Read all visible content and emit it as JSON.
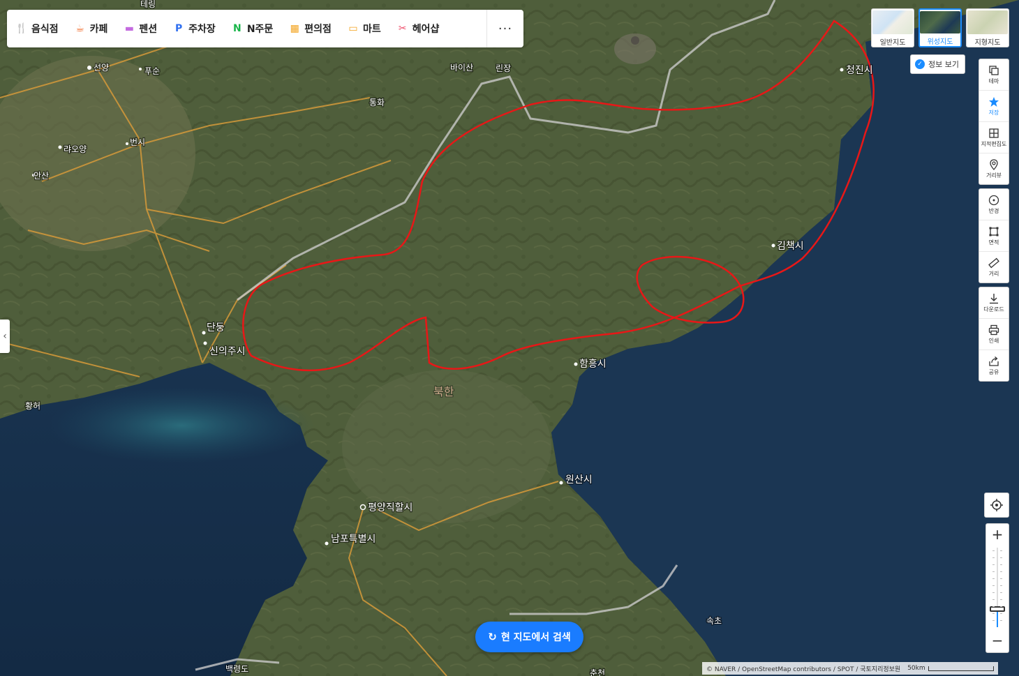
{
  "categories": [
    {
      "label": "음식점",
      "icon": "fork-knife-icon",
      "color": "#f2763b",
      "glyph": "🍴"
    },
    {
      "label": "카페",
      "icon": "coffee-cup-icon",
      "color": "#f2763b",
      "glyph": "☕"
    },
    {
      "label": "펜션",
      "icon": "bed-icon",
      "color": "#c46be0",
      "glyph": "▬"
    },
    {
      "label": "주차장",
      "icon": "parking-icon",
      "color": "#2f6ff0",
      "glyph": "P"
    },
    {
      "label": "N주문",
      "icon": "order-icon",
      "color": "#19b54a",
      "glyph": "N"
    },
    {
      "label": "편의점",
      "icon": "store-icon",
      "color": "#f3a21c",
      "glyph": "▦"
    },
    {
      "label": "마트",
      "icon": "cart-icon",
      "color": "#f3a21c",
      "glyph": "▭"
    },
    {
      "label": "헤어샵",
      "icon": "scissors-icon",
      "color": "#ee4d6a",
      "glyph": "✂"
    }
  ],
  "more_label": "···",
  "map_types": [
    {
      "label": "일반지도",
      "active": false
    },
    {
      "label": "위성지도",
      "active": true
    },
    {
      "label": "지형지도",
      "active": false
    }
  ],
  "info_toggle": {
    "label": "정보 보기",
    "checked": true
  },
  "tools_group1": [
    {
      "label": "테마",
      "icon": "layers-icon"
    },
    {
      "label": "저장",
      "icon": "star-icon"
    },
    {
      "label": "지적편집도",
      "icon": "cadastral-icon"
    },
    {
      "label": "거리뷰",
      "icon": "street-view-icon"
    }
  ],
  "tools_group2": [
    {
      "label": "반경",
      "icon": "radius-icon"
    },
    {
      "label": "면적",
      "icon": "area-icon"
    },
    {
      "label": "거리",
      "icon": "ruler-icon"
    }
  ],
  "tools_group3": [
    {
      "label": "다운로드",
      "icon": "download-icon"
    },
    {
      "label": "인쇄",
      "icon": "print-icon"
    },
    {
      "label": "공유",
      "icon": "share-icon"
    }
  ],
  "zoom": {
    "in": "+",
    "out": "−",
    "level_fraction": 0.2
  },
  "search_button": "현 지도에서 검색",
  "attribution": "© NAVER / OpenStreetMap contributors / SPOT / 국토지리정보원",
  "scale_label": "50km",
  "place_labels": {
    "teryng": "테링",
    "shenyang": "선양",
    "fushun": "푸순",
    "liaoyang": "랴오양",
    "benxi": "번시",
    "anshan": "안산",
    "baishan": "바이산",
    "linjiang": "린장",
    "tonghua": "통화",
    "dandong": "단둥",
    "sinuiju": "신의주시",
    "hwanghae": "황허",
    "chongjin": "청진시",
    "kimchaek": "김책시",
    "hamhung": "함흥시",
    "north_korea": "북한",
    "wonsan": "원산시",
    "pyongyang": "평양직할시",
    "nampo": "남포특별시",
    "sokcho": "속초",
    "baengnyeongdo": "백령도",
    "chuncheon": "춘천"
  }
}
